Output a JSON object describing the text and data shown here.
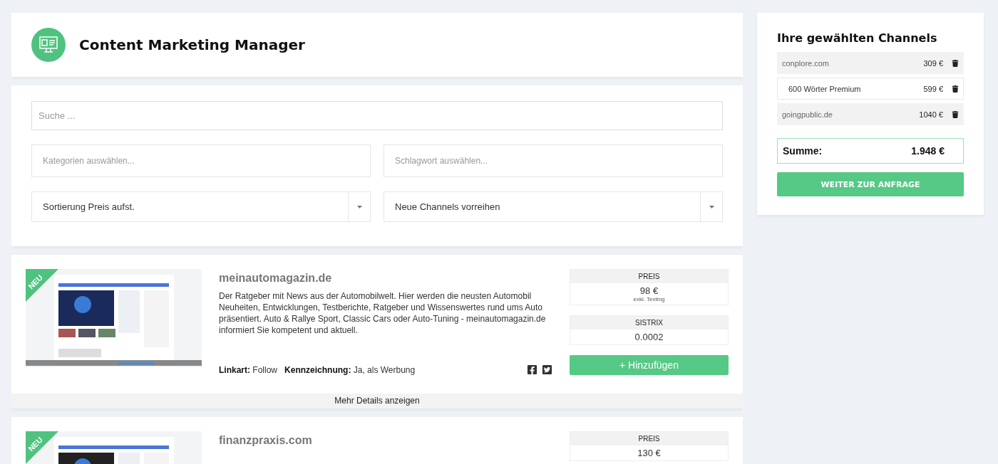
{
  "header": {
    "title": "Content Marketing Manager"
  },
  "filters": {
    "search": {
      "placeholder": "Suche ..."
    },
    "categories": {
      "placeholder": "Kategorien auswählen..."
    },
    "tags": {
      "placeholder": "Schlagwort auswählen..."
    },
    "sort": {
      "value": "Sortierung Preis aufst."
    },
    "order": {
      "value": "Neue Channels vorreihen"
    }
  },
  "listings": [
    {
      "badge": "NEU",
      "domain": "meinautomagazin.de",
      "description": "Der Ratgeber mit News aus der Automobilwelt. Hier werden die neusten Automobil Neuheiten, Entwicklungen, Testberichte, Ratgeber und Wissenswertes rund ums Auto präsentiert. Auto & Rallye Sport, Classic Cars oder Auto-Tuning - meinautomagazin.de informiert Sie kompetent und aktuell.",
      "link_type_label": "Linkart:",
      "link_type": "Follow",
      "marking_label": "Kennzeichnung:",
      "marking": "Ja, als Werbung",
      "price_label": "PREIS",
      "price": "98 €",
      "price_note": "exkl. Texting",
      "sistrix_label": "SISTRIX",
      "sistrix": "0.0002",
      "add_button": "+ Hinzufügen",
      "details": "Mehr Details anzeigen"
    },
    {
      "badge": "NEU",
      "domain": "finanzpraxis.com",
      "price_label": "PREIS",
      "price": "130 €"
    }
  ],
  "cart": {
    "title": "Ihre gewählten Channels",
    "items": [
      {
        "kind": "channel",
        "name": "conplore.com",
        "price": "309 €"
      },
      {
        "kind": "addon",
        "name": "600 Wörter Premium",
        "price": "599 €"
      },
      {
        "kind": "channel",
        "name": "goingpublic.de",
        "price": "1040 €"
      }
    ],
    "total_label": "Summe:",
    "total": "1.948 €",
    "submit": "WEITER ZUR ANFRAGE"
  }
}
